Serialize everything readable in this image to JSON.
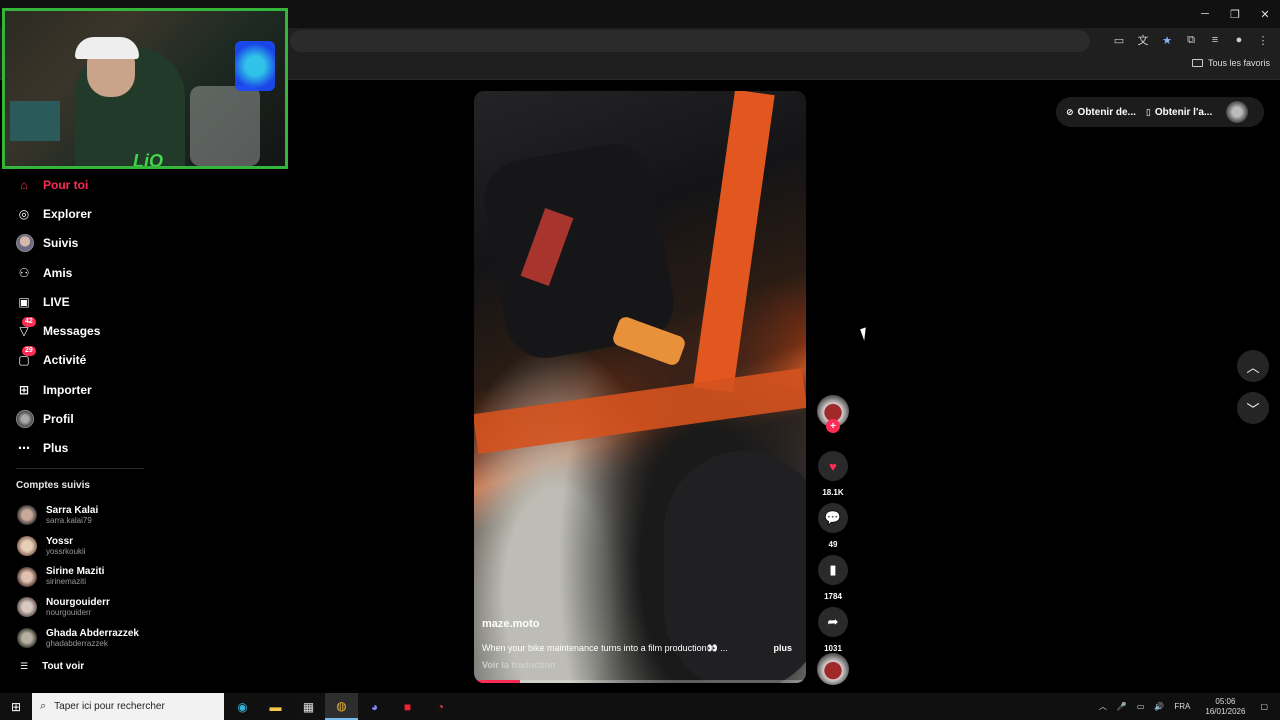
{
  "browser": {
    "window_controls": [
      "─",
      "❐",
      "✕"
    ],
    "bookmarks_all_label": "Tous les favoris"
  },
  "sidebar": {
    "items": [
      {
        "label": "Pour toi",
        "icon": "home-icon",
        "active": true
      },
      {
        "label": "Explorer",
        "icon": "compass-icon"
      },
      {
        "label": "Suivis",
        "icon": "avatar-icon"
      },
      {
        "label": "Amis",
        "icon": "friends-icon"
      },
      {
        "label": "LIVE",
        "icon": "live-tv-icon"
      },
      {
        "label": "Messages",
        "icon": "messages-icon",
        "badge": "42"
      },
      {
        "label": "Activité",
        "icon": "activity-icon",
        "badge": "29"
      },
      {
        "label": "Importer",
        "icon": "plus-square-icon"
      },
      {
        "label": "Profil",
        "icon": "profile-icon"
      },
      {
        "label": "Plus",
        "icon": "more-icon"
      }
    ],
    "following_title": "Comptes suivis",
    "following": [
      {
        "name": "Sarra Kalai",
        "handle": "sarra.kalai79"
      },
      {
        "name": "Yossr",
        "handle": "yossrkoukii"
      },
      {
        "name": "Sirine Maziti",
        "handle": "sirinemaziti"
      },
      {
        "name": "Nourgouiderr",
        "handle": "nourgouiderr"
      },
      {
        "name": "Ghada Abderrazzek",
        "handle": "ghadabderrazzek"
      }
    ],
    "see_all": "Tout voir"
  },
  "video": {
    "username": "maze.moto",
    "description": "When your bike maintenance turns into a film production👀 ...",
    "more": "plus",
    "translate": "Voir la traduction",
    "progress": 0.14
  },
  "actions": {
    "likes": "18.1K",
    "comments": "49",
    "saves": "1784",
    "shares": "1031"
  },
  "top_right": {
    "get_coins": "Obtenir de...",
    "get_app": "Obtenir l'a..."
  },
  "webcam_overlay_text": "LiO",
  "taskbar": {
    "search_placeholder": "Taper ici pour rechercher",
    "lang": "FRA",
    "time": "05:06",
    "date": "16/01/2026"
  },
  "colors": {
    "accent": "#fe2c55",
    "webcam_border": "#35b53a"
  }
}
